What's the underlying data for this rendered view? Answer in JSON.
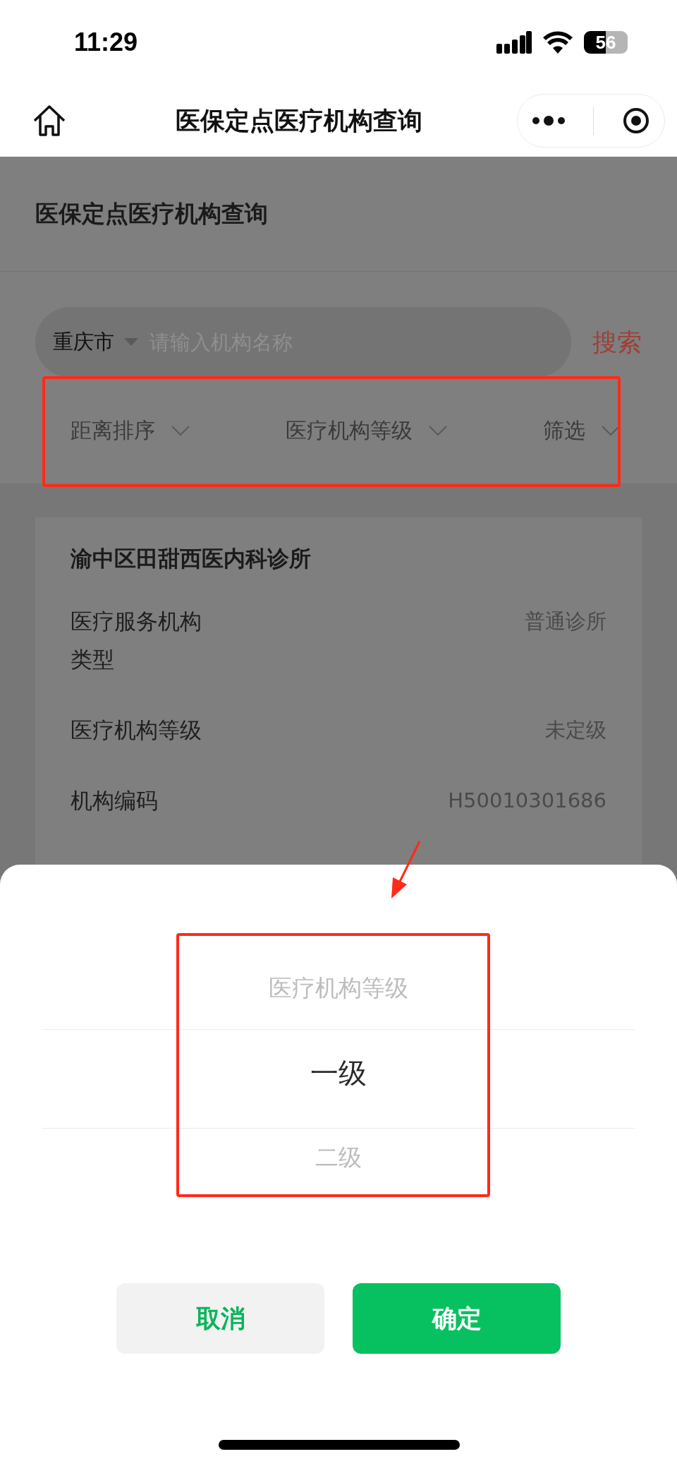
{
  "status_bar": {
    "time": "11:29",
    "battery": "56"
  },
  "nav_bar": {
    "title": "医保定点医疗机构查询"
  },
  "page": {
    "title": "医保定点医疗机构查询"
  },
  "search": {
    "city": "重庆市",
    "placeholder": "请输入机构名称",
    "button": "搜索"
  },
  "filters": [
    {
      "label": "距离排序"
    },
    {
      "label": "医疗机构等级"
    },
    {
      "label": "筛选"
    }
  ],
  "card": {
    "name": "渝中区田甜西医内科诊所",
    "rows": [
      {
        "label": "医疗服务机构类型",
        "value": "普通诊所"
      },
      {
        "label": "医疗机构等级",
        "value": "未定级"
      },
      {
        "label": "机构编码",
        "value": "H50010301686"
      }
    ]
  },
  "picker": {
    "items": [
      {
        "label": "医疗机构等级",
        "selected": false
      },
      {
        "label": "一级",
        "selected": true
      },
      {
        "label": "二级",
        "selected": false
      }
    ]
  },
  "buttons": [
    {
      "label": "取消",
      "kind": "secondary"
    },
    {
      "label": "确定",
      "kind": "primary"
    }
  ]
}
